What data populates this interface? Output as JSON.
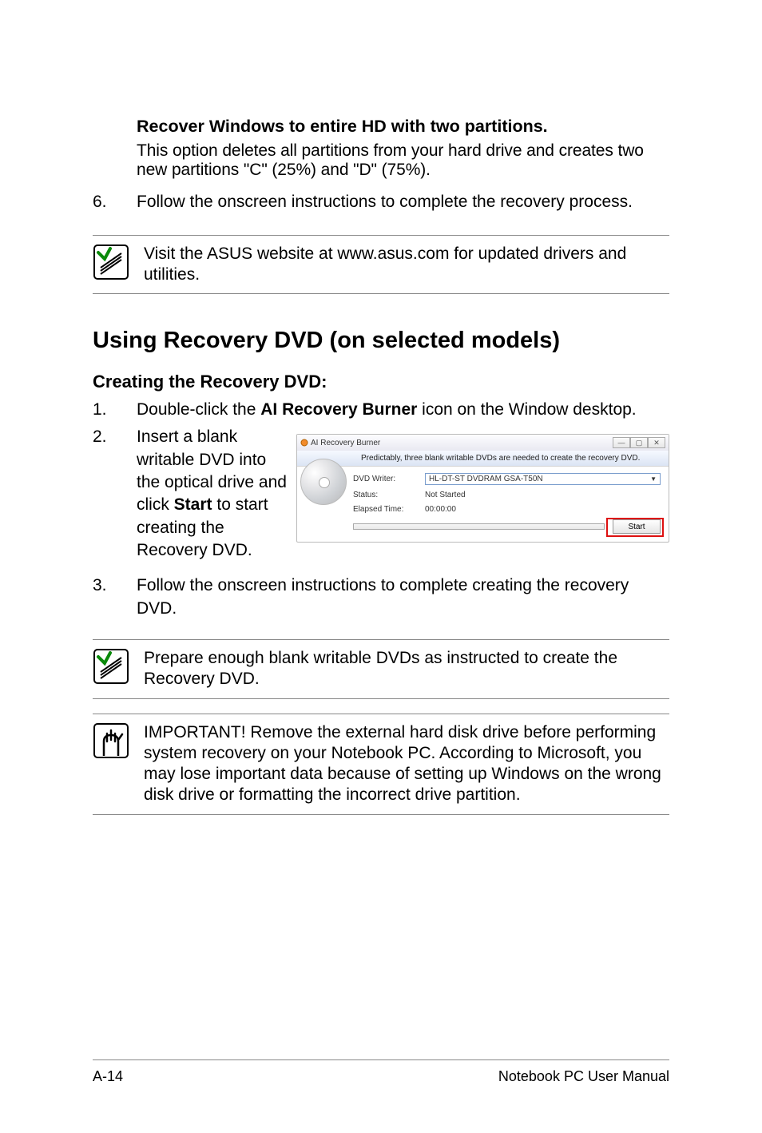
{
  "option": {
    "title": "Recover Windows to entire HD with two partitions.",
    "desc": "This option deletes all partitions from your hard drive and creates two new partitions \"C\" (25%) and \"D\" (75%)."
  },
  "step6": {
    "num": "6.",
    "text": "Follow the onscreen instructions to complete the recovery process."
  },
  "note1": "Visit the ASUS website at www.asus.com for updated drivers and utilities.",
  "section_heading": "Using Recovery DVD (on selected models)",
  "subheading": "Creating the Recovery DVD:",
  "steps": {
    "1": {
      "num": "1.",
      "pre": "Double-click the ",
      "bold": "AI Recovery Burner",
      "post": " icon on the Window desktop."
    },
    "2": {
      "num": "2.",
      "pretext": "Insert a blank writable DVD into the optical drive and click ",
      "bold": "Start",
      "post": " to start creating the Recovery DVD."
    },
    "3": {
      "num": "3.",
      "text": "Follow the onscreen instructions to complete creating the recovery DVD."
    }
  },
  "dialog": {
    "title": "AI Recovery Burner",
    "hint": "Predictably, three blank writable DVDs are needed to create the recovery DVD.",
    "labels": {
      "writer": "DVD Writer:",
      "status": "Status:",
      "elapsed": "Elapsed Time:"
    },
    "values": {
      "writer": "HL-DT-ST DVDRAM GSA-T50N",
      "status": "Not Started",
      "elapsed": "00:00:00"
    },
    "start_label": "Start"
  },
  "note2": "Prepare enough blank writable DVDs as instructed to create the Recovery DVD.",
  "note3": "IMPORTANT! Remove the external hard disk drive before performing system recovery on your Notebook PC. According to Microsoft, you may lose important data because of setting up Windows on the wrong disk drive or formatting the incorrect drive partition.",
  "footer": {
    "page": "A-14",
    "book": "Notebook PC User Manual"
  }
}
